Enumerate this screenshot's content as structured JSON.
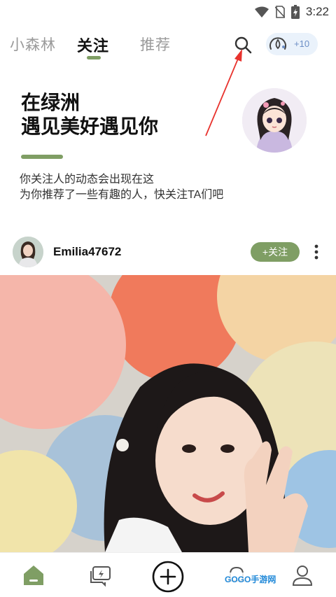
{
  "status_bar": {
    "time": "3:22",
    "icons": [
      "wifi-icon",
      "no-sim-icon",
      "battery-icon"
    ]
  },
  "top_nav": {
    "tabs": [
      {
        "label": "小森林",
        "active": false
      },
      {
        "label": "关注",
        "active": true
      },
      {
        "label": "推荐",
        "active": false
      }
    ],
    "eco_badge": {
      "count": "+10"
    }
  },
  "hero": {
    "title_line1": "在绿洲",
    "title_line2": "遇见美好遇见你",
    "desc_line1": "你关注人的动态会出现在这",
    "desc_line2": "为你推荐了一些有趣的人，快关注TA们吧"
  },
  "post": {
    "username": "Emilia47672",
    "follow_label": "+关注"
  },
  "bottom_nav": {
    "items": [
      "home-icon",
      "messages-icon",
      "add-icon",
      "notifications-icon",
      "profile-icon"
    ]
  },
  "watermark": "GOGO手游网",
  "colors": {
    "accent_green": "#7f9e64",
    "eco_blue": "#6d8fc6",
    "annotation_red": "#e8322d"
  }
}
